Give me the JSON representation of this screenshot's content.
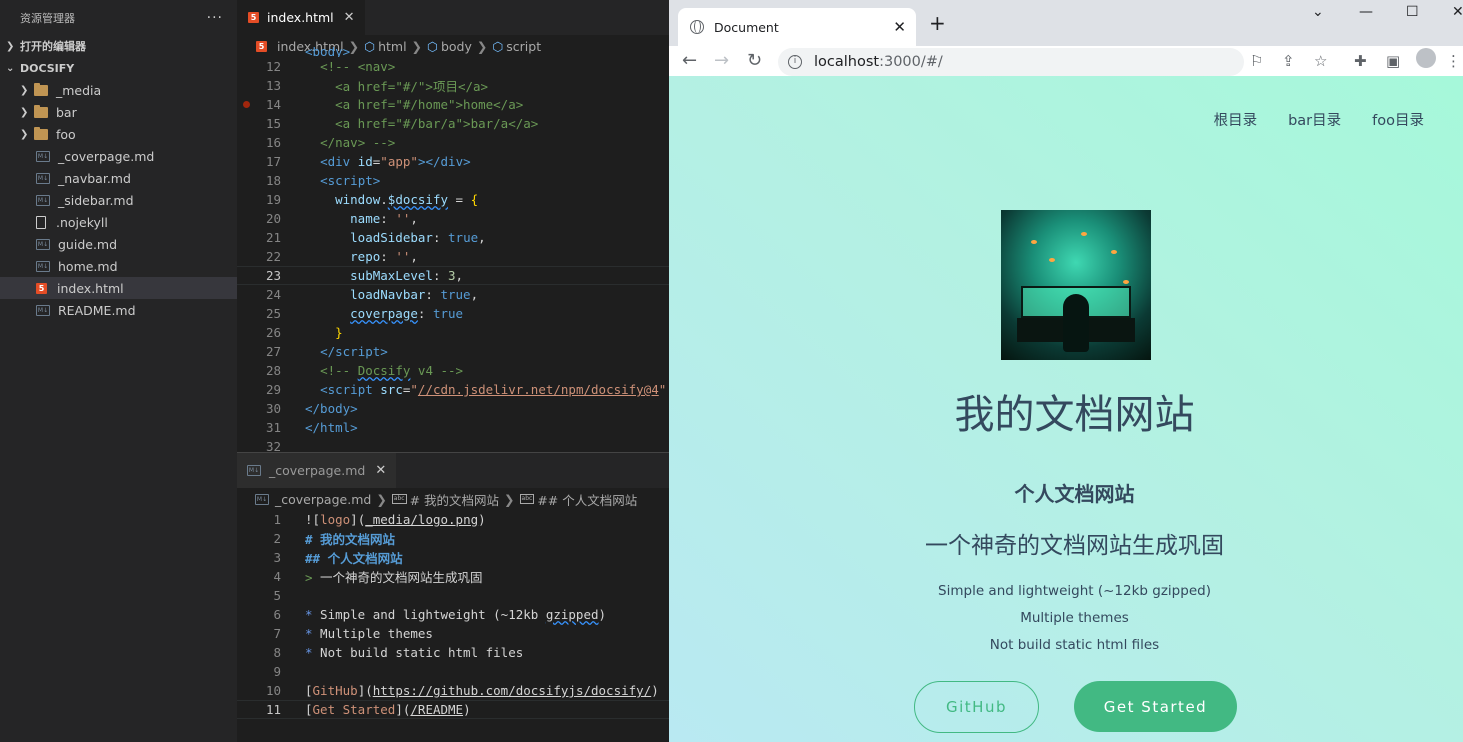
{
  "explorer": {
    "title": "资源管理器",
    "more": "···",
    "open_editors": "打开的编辑器",
    "workspace": "DOCSIFY",
    "folders": [
      "_media",
      "bar",
      "foo"
    ],
    "files": [
      "_coverpage.md",
      "_navbar.md",
      "_sidebar.md",
      ".nojekyll",
      "guide.md",
      "home.md",
      "index.html",
      "README.md"
    ],
    "active_file": "index.html"
  },
  "editor_top": {
    "tab_label": "index.html",
    "breadcrumb": [
      "index.html",
      "html",
      "body",
      "script"
    ],
    "line_numbers": [
      "12",
      "13",
      "14",
      "15",
      "16",
      "17",
      "18",
      "19",
      "20",
      "21",
      "22",
      "23",
      "24",
      "25",
      "26",
      "27",
      "28",
      "29",
      "30",
      "31",
      "32"
    ],
    "current_line": "23",
    "breakpoint_line": "14",
    "partial_top": "<body>"
  },
  "editor_bottom": {
    "tab_label": "_coverpage.md",
    "breadcrumb": [
      "_coverpage.md",
      "# 我的文档网站",
      "## 个人文档网站"
    ],
    "line_numbers": [
      "1",
      "2",
      "3",
      "4",
      "5",
      "6",
      "7",
      "8",
      "9",
      "10",
      "11"
    ],
    "current_line": "11"
  },
  "browser": {
    "tab_title": "Document",
    "url_host": "localhost",
    "url_path": ":3000/#/",
    "nav_links": [
      "根目录",
      "bar目录",
      "foo目录"
    ],
    "cover_title": "我的文档网站",
    "cover_subtitle": "个人文档网站",
    "cover_quote": "一个神奇的文档网站生成巩固",
    "features": [
      "Simple and lightweight (~12kb gzipped)",
      "Multiple themes",
      "Not build static html files"
    ],
    "button_github": "GitHub",
    "button_start": "Get Started",
    "accent_color": "#42b983"
  }
}
